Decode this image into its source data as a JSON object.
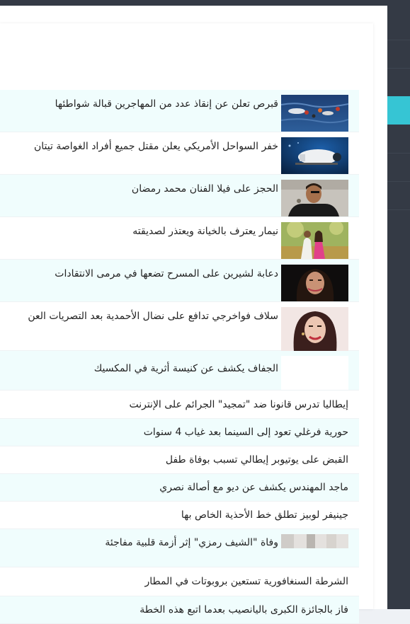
{
  "news": {
    "items": [
      {
        "title": "قبرص تعلن عن إنقاذ عدد من المهاجرين قبالة شواطئها",
        "image": "migrants-sea-photo"
      },
      {
        "title": "خفر السواحل الأمريكي يعلن مقتل جميع أفراد الغواصة تيتان",
        "image": "submarine-photo"
      },
      {
        "title": "الحجز على فيلا الفنان محمد رمضان",
        "image": "actor-portrait-photo"
      },
      {
        "title": "نيمار يعترف بالخيانة ويعتذر لصديقته",
        "image": "couple-photo"
      },
      {
        "title": "دعابة لشيرين على المسرح تضعها في مرمى الانتقادات",
        "image": "singer-portrait-photo"
      },
      {
        "title": "سلاف فواخرجي تدافع على نضال الأحمدية بعد التصريات العن",
        "image": "actress-portrait-photo"
      },
      {
        "title": "الجفاف يكشف عن كنيسة أثرية في المكسيك",
        "image": "blank-image"
      },
      {
        "title": "إيطاليا تدرس قانونا ضد \"تمجيد\" الجرائم على الإنترنت"
      },
      {
        "title": "حورية فرغلي تعود إلى السينما بعد غياب 4 سنوات"
      },
      {
        "title": "القبض على يوتيوبر إيطالي تسبب بوفاة طفل"
      },
      {
        "title": "ماجد المهندس يكشف عن ديو مع أصالة نصري"
      },
      {
        "title": "جينيفر لوبيز تطلق خط الأحذية الخاص بها"
      },
      {
        "title": "وفاة \"الشيف رمزي\" إثر أزمة قلبية مفاجئة",
        "image": "chef-photo"
      },
      {
        "title": "الشرطة السنغافورية تستعين بروبوتات في المطار"
      },
      {
        "title": "فاز بالجائزة الكبرى باليانصيب بعدما اتبع هذه الخطة"
      }
    ]
  },
  "colors": {
    "sidebar": "#343a45",
    "accent": "#36c5d4",
    "row_tint": "#f0fdfd",
    "text": "#222222"
  }
}
